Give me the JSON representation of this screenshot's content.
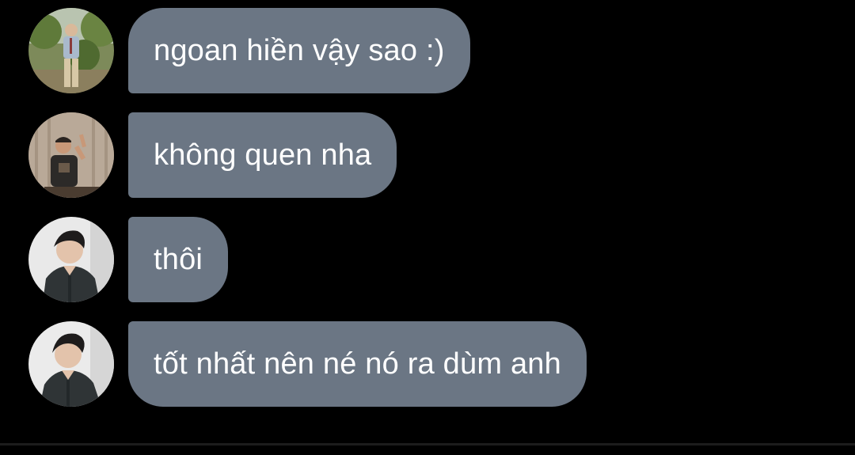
{
  "messages": [
    {
      "text": "ngoan hiền vậy sao :)",
      "avatar": "avatar-outdoor-man-icon"
    },
    {
      "text": "không quen nha",
      "avatar": "avatar-man-waving-icon"
    },
    {
      "text": "thôi",
      "avatar": "avatar-man-dark-shirt-icon"
    },
    {
      "text": "tốt nhất nên né nó ra dùm anh",
      "avatar": "avatar-man-dark-shirt-icon"
    }
  ],
  "colors": {
    "background": "#000000",
    "bubble": "#6b7684",
    "text": "#ffffff"
  }
}
